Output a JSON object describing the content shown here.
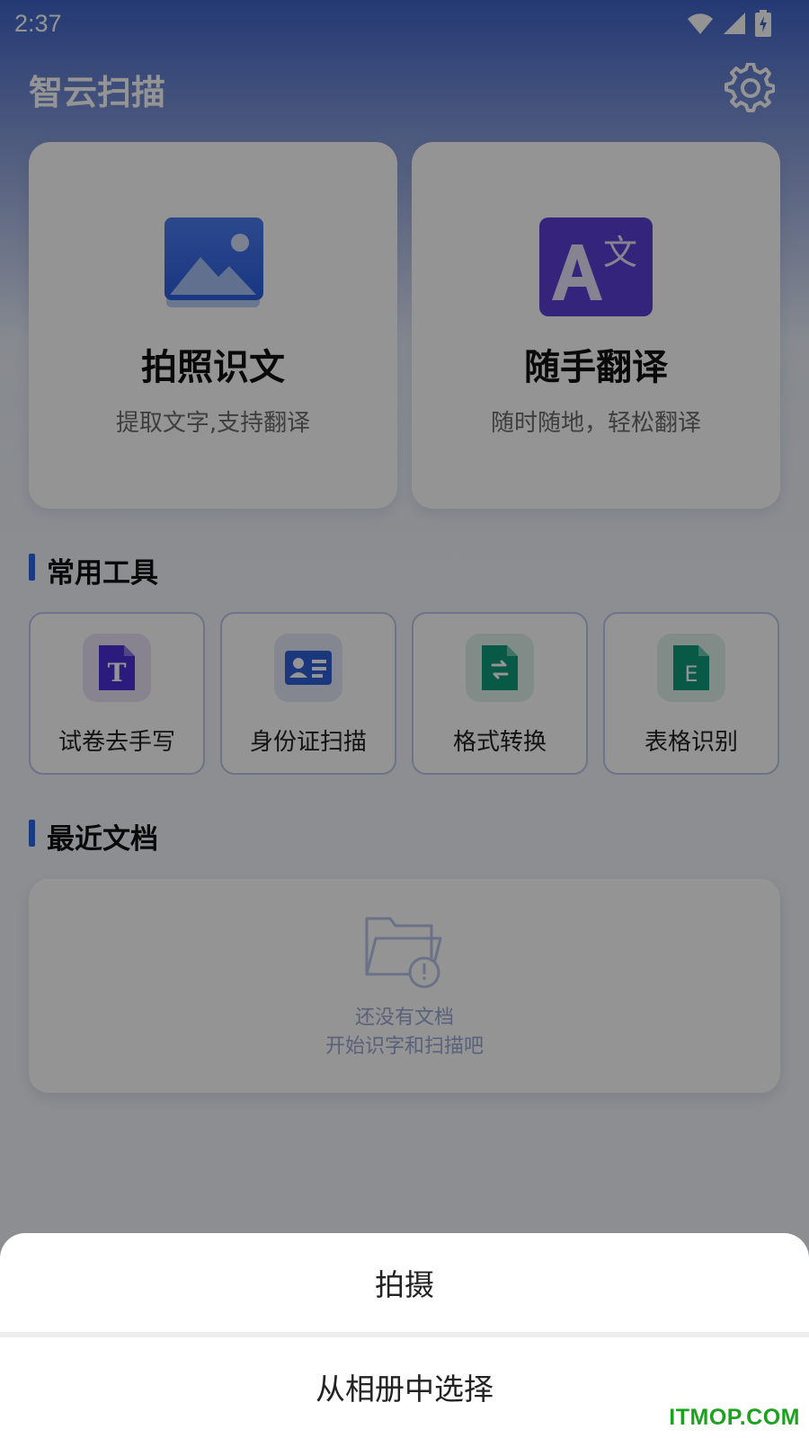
{
  "status_bar": {
    "time": "2:37",
    "icons": [
      "wifi-icon",
      "signal-icon",
      "battery-charging-icon"
    ]
  },
  "header": {
    "title": "智云扫描",
    "settings_icon": "gear-icon"
  },
  "feature_cards": [
    {
      "title": "拍照识文",
      "subtitle": "提取文字,支持翻译",
      "icon": "image-icon"
    },
    {
      "title": "随手翻译",
      "subtitle": "随时随地，轻松翻译",
      "icon": "translate-icon"
    }
  ],
  "tools_section": {
    "title": "常用工具",
    "items": [
      {
        "label": "试卷去手写",
        "icon": "text-file-icon",
        "color": "#4b2fd6"
      },
      {
        "label": "身份证扫描",
        "icon": "id-card-icon",
        "color": "#2f5fd8"
      },
      {
        "label": "格式转换",
        "icon": "convert-file-icon",
        "color": "#0f9a78"
      },
      {
        "label": "表格识别",
        "icon": "excel-file-icon",
        "color": "#0f9a78"
      }
    ]
  },
  "recent_section": {
    "title": "最近文档",
    "empty_line1": "还没有文档",
    "empty_line2": "开始识字和扫描吧"
  },
  "bottom_sheet": {
    "option_capture": "拍摄",
    "option_album": "从相册中选择"
  },
  "watermark": "ITMOP.COM",
  "colors": {
    "accent": "#2c66e0",
    "translate_bg": "#5a3fd6",
    "overlay": "rgba(0,0,0,0.42)"
  }
}
